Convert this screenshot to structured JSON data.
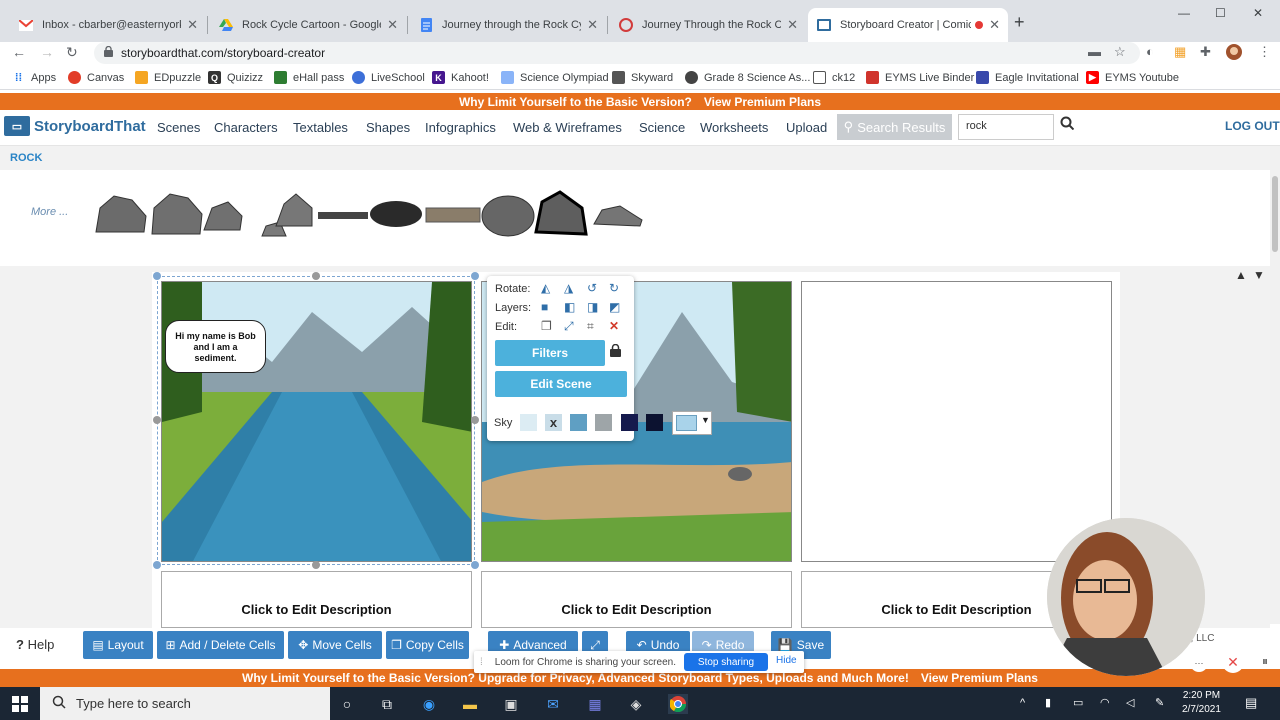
{
  "browser": {
    "tabs": [
      {
        "label": "Inbox - cbarber@easternyork.net",
        "icon": "gmail-icon"
      },
      {
        "label": "Rock Cycle Cartoon - Google Dri",
        "icon": "google-drive-icon"
      },
      {
        "label": "Journey through the Rock Cycle",
        "icon": "docs-icon"
      },
      {
        "label": "Journey Through the Rock Cycle",
        "icon": "storyboard-icon"
      },
      {
        "label": "Storyboard Creator | Comic S",
        "icon": "storyboard-icon",
        "active": true
      }
    ],
    "url": "storyboardthat.com/storyboard-creator",
    "bookmarks": [
      "Apps",
      "Canvas",
      "EDpuzzle",
      "Quizizz",
      "eHall pass",
      "LiveSchool",
      "Kahoot!",
      "Science Olympiad",
      "Skyward",
      "Grade 8 Science As...",
      "ck12",
      "EYMS Live Binder",
      "Eagle Invitational",
      "EYMS Youtube"
    ]
  },
  "promo": {
    "text": "Why Limit Yourself to the Basic Version?",
    "link": "View Premium Plans"
  },
  "promo_bottom": {
    "text": "Why Limit Yourself to the Basic Version? Upgrade for Privacy, Advanced Storyboard Types, Uploads and Much More!",
    "link": "View Premium Plans"
  },
  "nav": {
    "logo": "StoryboardThat",
    "menu": [
      "Scenes",
      "Characters",
      "Textables",
      "Shapes",
      "Infographics",
      "Web & Wireframes",
      "Science",
      "Worksheets",
      "Upload"
    ],
    "search_results": "Search Results",
    "search_value": "rock",
    "logout": "LOG OUT"
  },
  "library": {
    "tag": "ROCK",
    "more": "More ..."
  },
  "cells": {
    "bubble": "Hi my name is Bob and I am a sediment.",
    "desc": [
      "Click to Edit Description",
      "Click to Edit Description",
      "Click to Edit Description"
    ]
  },
  "popup": {
    "rotate": "Rotate:",
    "layers": "Layers:",
    "edit": "Edit:",
    "filters": "Filters",
    "edit_scene": "Edit Scene",
    "sky": "Sky",
    "sky_colors": [
      "#dcecf3",
      "#c9dde8",
      "#5f9fc3",
      "#9ea5a8",
      "#151a4d",
      "#0c1230"
    ],
    "selected_sky": "#a9d3ea"
  },
  "bottom": {
    "help": "Help",
    "buttons": [
      "Layout",
      "Add / Delete Cells",
      "Move Cells",
      "Copy Cells",
      "Advanced",
      "Undo",
      "Redo",
      "Save"
    ],
    "copyright": "es, LLC"
  },
  "loom": {
    "text": "Loom for Chrome is sharing your screen.",
    "stop": "Stop sharing",
    "hide": "Hide"
  },
  "taskbar": {
    "search_placeholder": "Type here to search",
    "time": "2:20 PM",
    "date": "2/7/2021"
  }
}
